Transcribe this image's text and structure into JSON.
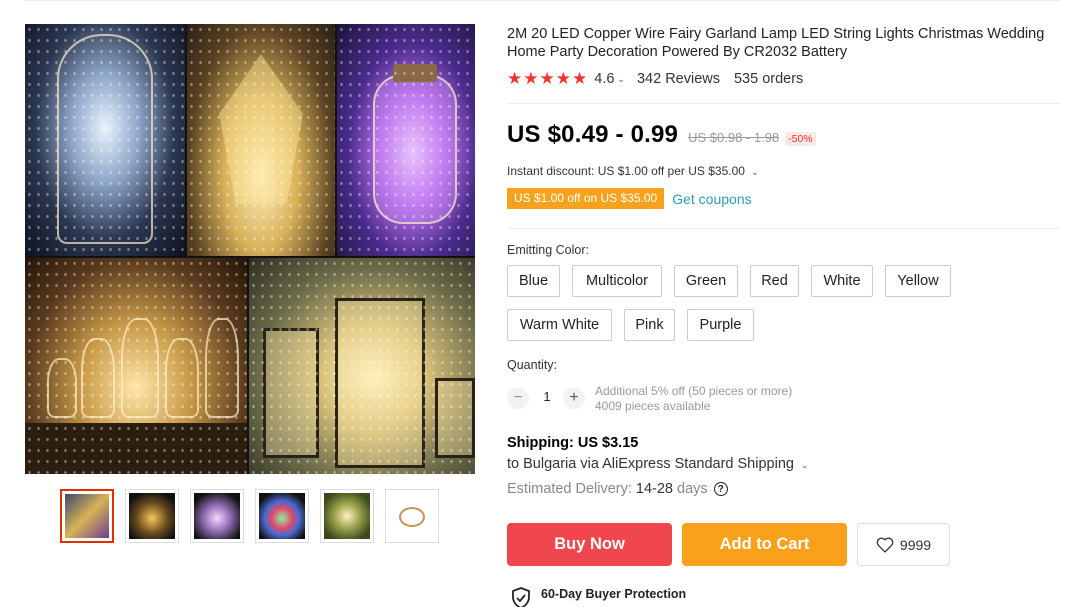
{
  "product": {
    "title": "2M 20 LED Copper Wire Fairy Garland Lamp LED String Lights Christmas Wedding Home Party Decoration Powered By CR2032 Battery",
    "rating": "4.6",
    "reviews": "342 Reviews",
    "orders": "535 orders",
    "stars_filled": 5
  },
  "price": {
    "current": "US $0.49 - 0.99",
    "original": "US $0.98 - 1.98",
    "discount": "-50%"
  },
  "discount": {
    "instant": "Instant discount: US $1.00 off per US $35.00",
    "coupon_tag": "US $1.00 off on US $35.00",
    "get_coupons": "Get coupons"
  },
  "color": {
    "label": "Emitting Color:",
    "options": [
      "Blue",
      "Multicolor",
      "Green",
      "Red",
      "White",
      "Yellow",
      "Warm White",
      "Pink",
      "Purple"
    ]
  },
  "quantity": {
    "label": "Quantity:",
    "value": "1",
    "minus": "−",
    "plus": "+",
    "bulk_note": "Additional 5% off (50 pieces or more)",
    "available": "4009 pieces available"
  },
  "shipping": {
    "title": "Shipping: US $3.15",
    "destination": "to Bulgaria via AliExpress Standard Shipping",
    "delivery_label": "Estimated Delivery:",
    "delivery_days": "14-28",
    "delivery_unit": "days",
    "help_glyph": "?"
  },
  "actions": {
    "buy_now": "Buy Now",
    "add_to_cart": "Add to Cart",
    "wishlist_count": "9999"
  },
  "protection": {
    "title": "60-Day Buyer Protection"
  },
  "icons": {
    "star": "★",
    "caret": "⌄",
    "heart": "heart-outline-icon",
    "shield": "shield-check-icon"
  },
  "colors": {
    "star": "#f03434",
    "buy_now": "#f0474f",
    "add_to_cart": "#f9a11b",
    "coupon": "#f7a21c",
    "link": "#2e9cc3"
  }
}
